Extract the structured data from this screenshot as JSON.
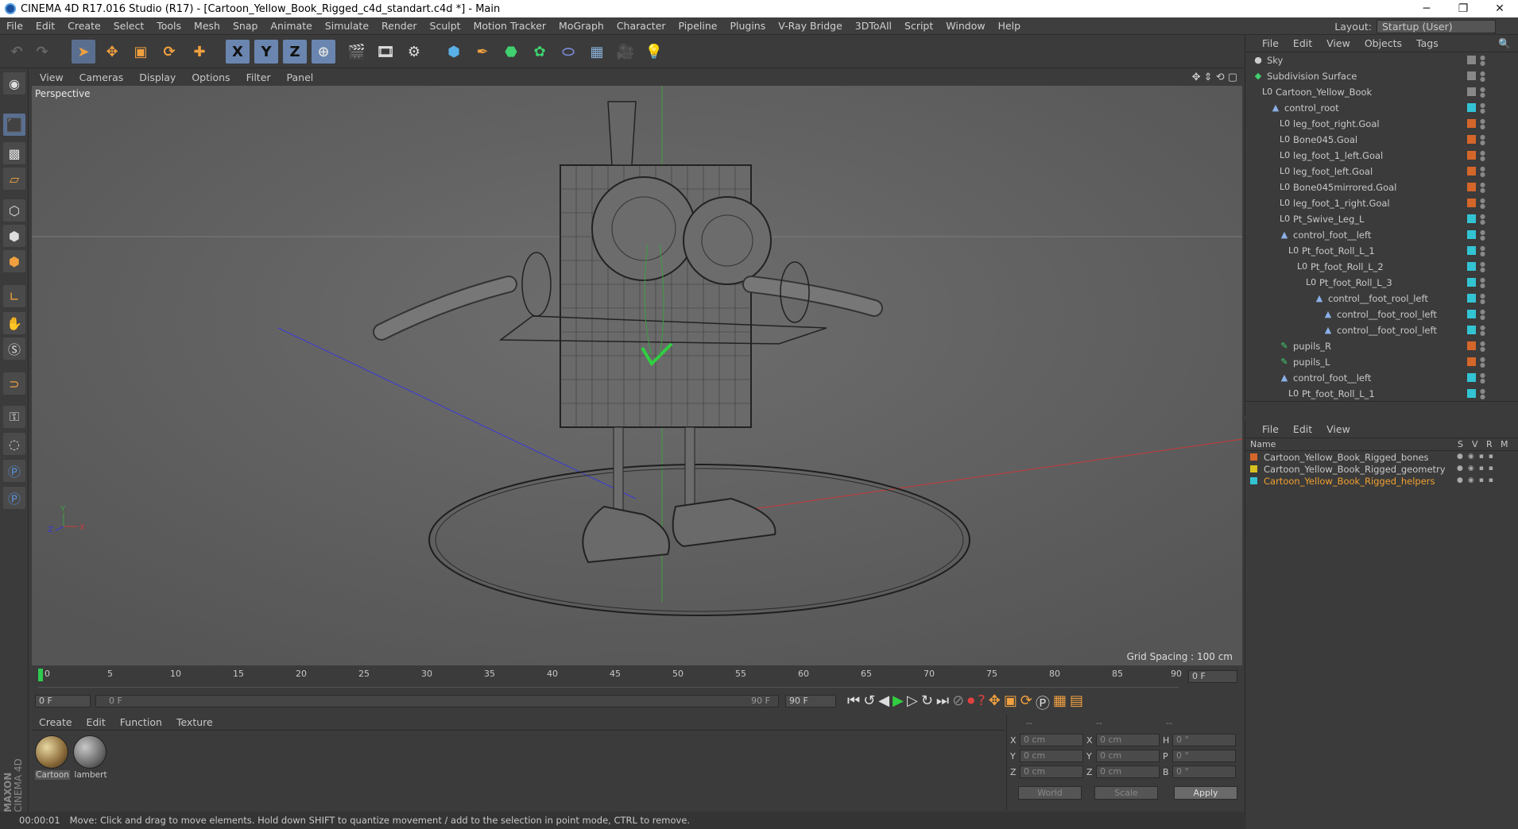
{
  "titlebar": {
    "title": "CINEMA 4D R17.016 Studio (R17) - [Cartoon_Yellow_Book_Rigged_c4d_standart.c4d *] - Main",
    "min": "─",
    "restore": "❐",
    "close": "✕"
  },
  "menubar": {
    "items": [
      "File",
      "Edit",
      "Create",
      "Select",
      "Tools",
      "Mesh",
      "Snap",
      "Animate",
      "Simulate",
      "Render",
      "Sculpt",
      "Motion Tracker",
      "MoGraph",
      "Character",
      "Pipeline",
      "Plugins",
      "V-Ray Bridge",
      "3DToAll",
      "Script",
      "Window",
      "Help"
    ],
    "layout_label": "Layout:",
    "layout_value": "Startup (User)"
  },
  "toolbar": {
    "x_label": "X",
    "y_label": "Y",
    "z_label": "Z"
  },
  "viewport": {
    "menu": [
      "View",
      "Cameras",
      "Display",
      "Options",
      "Filter",
      "Panel"
    ],
    "label": "Perspective",
    "grid_spacing": "Grid Spacing : 100 cm",
    "axis_y": "Y",
    "axis_x": "X",
    "axis_z": "Z"
  },
  "timeline": {
    "ticks": [
      "0",
      "5",
      "10",
      "15",
      "20",
      "25",
      "30",
      "35",
      "40",
      "45",
      "50",
      "55",
      "60",
      "65",
      "70",
      "75",
      "80",
      "85",
      "90"
    ],
    "current_frame": "0 F"
  },
  "transport": {
    "start": "0 F",
    "range_start": "0 F",
    "range_end": "90 F",
    "end": "90 F"
  },
  "material_manager": {
    "menu": [
      "Create",
      "Edit",
      "Function",
      "Texture"
    ],
    "materials": [
      {
        "name": "Cartoon"
      },
      {
        "name": "lambert"
      }
    ]
  },
  "coords": {
    "headers": [
      "--",
      "--",
      "--"
    ],
    "rows": [
      {
        "a": "X",
        "av": "0 cm",
        "b": "X",
        "bv": "0 cm",
        "c": "H",
        "cv": "0 °"
      },
      {
        "a": "Y",
        "av": "0 cm",
        "b": "Y",
        "bv": "0 cm",
        "c": "P",
        "cv": "0 °"
      },
      {
        "a": "Z",
        "av": "0 cm",
        "b": "Z",
        "bv": "0 cm",
        "c": "B",
        "cv": "0 °"
      }
    ],
    "world": "World",
    "scale": "Scale",
    "apply": "Apply"
  },
  "statusbar": {
    "time": "00:00:01",
    "message": "Move: Click and drag to move elements. Hold down SHIFT to quantize movement / add to the selection in point mode, CTRL to remove."
  },
  "object_manager": {
    "menu": [
      "File",
      "Edit",
      "View",
      "Objects",
      "Tags"
    ],
    "objects": [
      {
        "name": "Sky",
        "indent": 0,
        "icon": "●",
        "tag": "#888888"
      },
      {
        "name": "Subdivision Surface",
        "indent": 0,
        "icon": "◆",
        "tag": "#888888"
      },
      {
        "name": "Cartoon_Yellow_Book",
        "indent": 1,
        "icon": "L0",
        "tag": "#888888"
      },
      {
        "name": "control_root",
        "indent": 2,
        "icon": "▲",
        "tag": "#33c4d4"
      },
      {
        "name": "leg_foot_right.Goal",
        "indent": 3,
        "icon": "L0",
        "tag": "#d4662a"
      },
      {
        "name": "Bone045.Goal",
        "indent": 3,
        "icon": "L0",
        "tag": "#d4662a"
      },
      {
        "name": "leg_foot_1_left.Goal",
        "indent": 3,
        "icon": "L0",
        "tag": "#d4662a"
      },
      {
        "name": "leg_foot_left.Goal",
        "indent": 3,
        "icon": "L0",
        "tag": "#d4662a"
      },
      {
        "name": "Bone045mirrored.Goal",
        "indent": 3,
        "icon": "L0",
        "tag": "#d4662a"
      },
      {
        "name": "leg_foot_1_right.Goal",
        "indent": 3,
        "icon": "L0",
        "tag": "#d4662a"
      },
      {
        "name": "Pt_Swive_Leg_L",
        "indent": 3,
        "icon": "L0",
        "tag": "#33c4d4"
      },
      {
        "name": "control_foot__left",
        "indent": 3,
        "icon": "▲",
        "tag": "#33c4d4"
      },
      {
        "name": "Pt_foot_Roll_L_1",
        "indent": 4,
        "icon": "L0",
        "tag": "#33c4d4"
      },
      {
        "name": "Pt_foot_Roll_L_2",
        "indent": 5,
        "icon": "L0",
        "tag": "#33c4d4"
      },
      {
        "name": "Pt_foot_Roll_L_3",
        "indent": 6,
        "icon": "L0",
        "tag": "#33c4d4"
      },
      {
        "name": "control__foot_rool_left",
        "indent": 7,
        "icon": "▲",
        "tag": "#33c4d4"
      },
      {
        "name": "control__foot_rool_left",
        "indent": 8,
        "icon": "▲",
        "tag": "#33c4d4"
      },
      {
        "name": "control__foot_rool_left",
        "indent": 8,
        "icon": "▲",
        "tag": "#33c4d4"
      },
      {
        "name": "pupils_R",
        "indent": 3,
        "icon": "✎",
        "tag": "#d4662a"
      },
      {
        "name": "pupils_L",
        "indent": 3,
        "icon": "✎",
        "tag": "#d4662a"
      },
      {
        "name": "control_foot__left",
        "indent": 3,
        "icon": "▲",
        "tag": "#33c4d4"
      },
      {
        "name": "Pt_foot_Roll_L_1",
        "indent": 4,
        "icon": "L0",
        "tag": "#33c4d4"
      }
    ]
  },
  "layer_manager": {
    "menu": [
      "File",
      "Edit",
      "View"
    ],
    "header": {
      "name": "Name",
      "s": "S",
      "v": "V",
      "r": "R",
      "m": "M"
    },
    "layers": [
      {
        "name": "Cartoon_Yellow_Book_Rigged_bones",
        "color": "#d4662a",
        "text_color": "#c8c8c8"
      },
      {
        "name": "Cartoon_Yellow_Book_Rigged_geometry",
        "color": "#d8c020",
        "text_color": "#c8c8c8"
      },
      {
        "name": "Cartoon_Yellow_Book_Rigged_helpers",
        "color": "#33c4d4",
        "text_color": "#f0a030"
      }
    ]
  },
  "side_brand": {
    "line1": "MAXON",
    "line2": "CINEMA 4D"
  }
}
